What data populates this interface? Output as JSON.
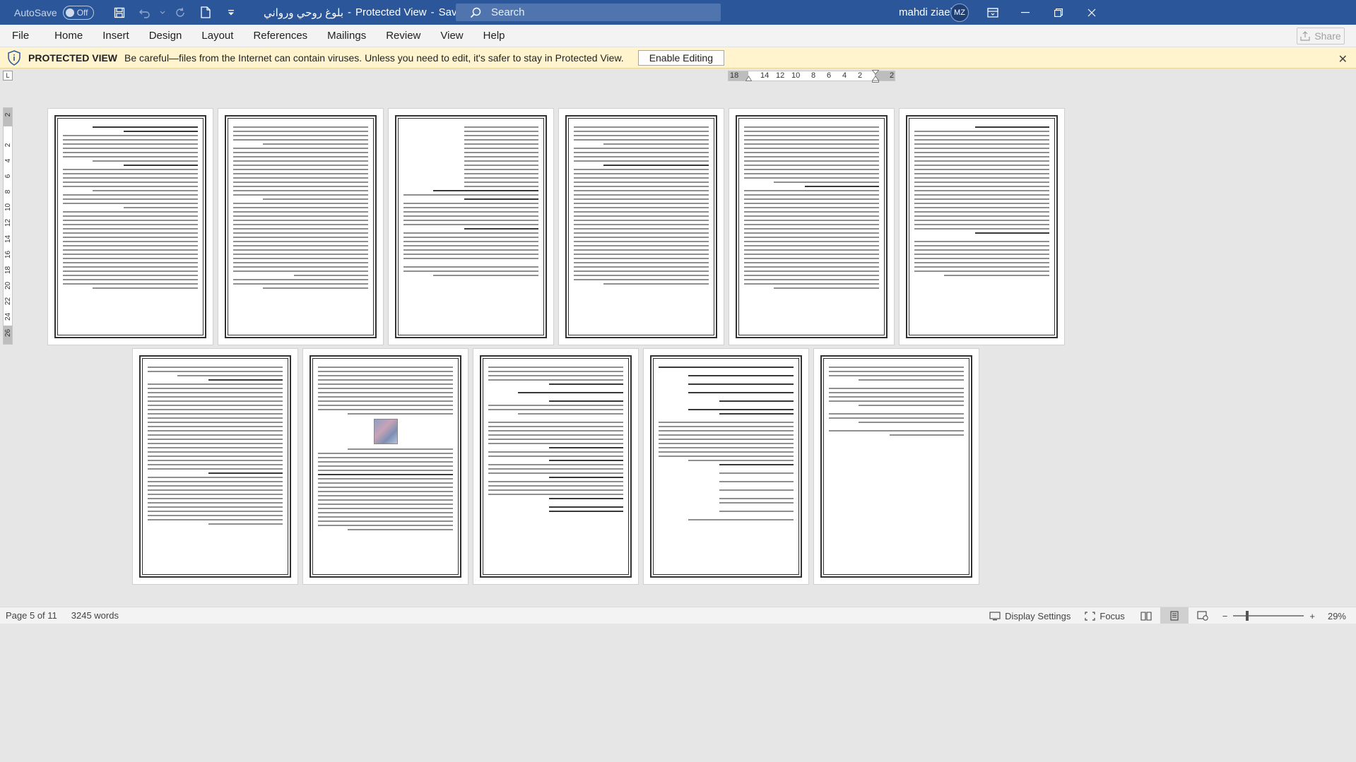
{
  "titlebar": {
    "autosave_label": "AutoSave",
    "autosave_state": "Off",
    "doc_name": "بلوغ روحي ورواني",
    "protected_label": "Protected View",
    "save_status": "Saved to this PC",
    "search_placeholder": "Search",
    "user_name": "mahdi ziaei",
    "user_initials": "MZ"
  },
  "menu": {
    "items": [
      "File",
      "Home",
      "Insert",
      "Design",
      "Layout",
      "References",
      "Mailings",
      "Review",
      "View",
      "Help"
    ],
    "share_label": "Share"
  },
  "protected_view": {
    "title": "PROTECTED VIEW",
    "message": "Be careful—files from the Internet can contain viruses. Unless you need to edit, it's safer to stay in Protected View.",
    "enable_button": "Enable Editing"
  },
  "ruler": {
    "ticks": [
      "18",
      "14",
      "12",
      "10",
      "8",
      "6",
      "4",
      "2",
      "2"
    ],
    "vertical_ticks": [
      "2",
      "2",
      "4",
      "6",
      "8",
      "10",
      "12",
      "14",
      "16",
      "18",
      "20",
      "22",
      "24",
      "26"
    ],
    "corner_symbol": "L"
  },
  "status": {
    "page": "Page 5 of 11",
    "words": "3245 words",
    "display_settings": "Display Settings",
    "focus": "Focus",
    "zoom": "29%",
    "zoom_level": 29
  }
}
